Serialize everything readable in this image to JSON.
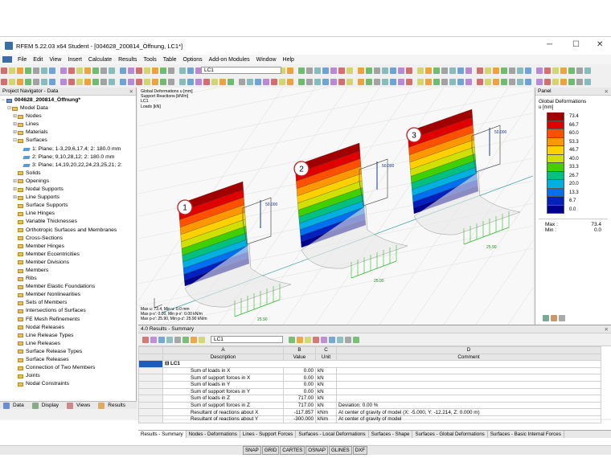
{
  "window": {
    "title": "RFEM 5.22.03 x64 Student - [004628_200814_Öffnung, LC1*]",
    "minimize": "─",
    "maximize": "☐",
    "close": "✕"
  },
  "menu": [
    "File",
    "Edit",
    "View",
    "Insert",
    "Calculate",
    "Results",
    "Tools",
    "Table",
    "Options",
    "Add-on Modules",
    "Window",
    "Help"
  ],
  "toolbar": {
    "loadcase": "LC1"
  },
  "navigator": {
    "title": "Project Navigator - Data",
    "root": "004628_200814_Öffnung*",
    "items": [
      {
        "label": "Model Data",
        "lvl": 1,
        "pm": "−"
      },
      {
        "label": "Nodes",
        "lvl": 2,
        "pm": "+"
      },
      {
        "label": "Lines",
        "lvl": 2,
        "pm": "+"
      },
      {
        "label": "Materials",
        "lvl": 2,
        "pm": "+"
      },
      {
        "label": "Surfaces",
        "lvl": 2,
        "pm": "−"
      },
      {
        "label": "1: Plane; 1-3,29,6,17,4; 2: 180.0 mm",
        "lvl": 3,
        "surf": true
      },
      {
        "label": "2: Plane; 9,10,28,12; 2: 180.0 mm",
        "lvl": 3,
        "surf": true
      },
      {
        "label": "3: Plane; 14,19,20,22,24,23,25,21; 2:",
        "lvl": 3,
        "surf": true
      },
      {
        "label": "Solids",
        "lvl": 2
      },
      {
        "label": "Openings",
        "lvl": 2,
        "pm": "+"
      },
      {
        "label": "Nodal Supports",
        "lvl": 2,
        "pm": "+"
      },
      {
        "label": "Line Supports",
        "lvl": 2,
        "pm": "+"
      },
      {
        "label": "Surface Supports",
        "lvl": 2
      },
      {
        "label": "Line Hinges",
        "lvl": 2
      },
      {
        "label": "Variable Thicknesses",
        "lvl": 2
      },
      {
        "label": "Orthotropic Surfaces and Membranes",
        "lvl": 2
      },
      {
        "label": "Cross-Sections",
        "lvl": 2
      },
      {
        "label": "Member Hinges",
        "lvl": 2
      },
      {
        "label": "Member Eccentricities",
        "lvl": 2
      },
      {
        "label": "Member Divisions",
        "lvl": 2
      },
      {
        "label": "Members",
        "lvl": 2
      },
      {
        "label": "Ribs",
        "lvl": 2
      },
      {
        "label": "Member Elastic Foundations",
        "lvl": 2
      },
      {
        "label": "Member Nonlinearities",
        "lvl": 2
      },
      {
        "label": "Sets of Members",
        "lvl": 2
      },
      {
        "label": "Intersections of Surfaces",
        "lvl": 2
      },
      {
        "label": "FE Mesh Refinements",
        "lvl": 2
      },
      {
        "label": "Nodal Releases",
        "lvl": 2
      },
      {
        "label": "Line Release Types",
        "lvl": 2
      },
      {
        "label": "Line Releases",
        "lvl": 2
      },
      {
        "label": "Surface Release Types",
        "lvl": 2
      },
      {
        "label": "Surface Releases",
        "lvl": 2
      },
      {
        "label": "Connection of Two Members",
        "lvl": 2
      },
      {
        "label": "Joints",
        "lvl": 2
      },
      {
        "label": "Nodal Constraints",
        "lvl": 2
      }
    ],
    "tabs": [
      "Data",
      "Display",
      "Views",
      "Results"
    ]
  },
  "viewport": {
    "info": [
      "Global Deformations u [mm]",
      "Support Reactions [kN/m]",
      "LC1",
      "Loads [kN]"
    ],
    "bottom": [
      "Max u: 73.4, Min u: 0.0 mm",
      "Max p-x': 0.00, Min p-x': 0.00 kN/m",
      "Max p-z': 25.90, Min p-z': 25.90 kN/m"
    ],
    "callouts": [
      "1",
      "2",
      "3"
    ],
    "loads": [
      "50.000",
      "50.000",
      "50.000"
    ],
    "reactions": [
      "25.90",
      "25.90",
      "25.90"
    ]
  },
  "panel": {
    "title": "Panel",
    "heading": "Global Deformations",
    "unit": "u [mm]",
    "legend": [
      "73.4",
      "66.7",
      "60.0",
      "53.3",
      "46.7",
      "40.0",
      "33.3",
      "26.7",
      "20.0",
      "13.3",
      "6.7",
      "0.0"
    ],
    "colors": [
      "#a00000",
      "#e00000",
      "#ff5000",
      "#ff9800",
      "#ffd000",
      "#d0e000",
      "#40d000",
      "#00c080",
      "#00b0e0",
      "#0070f0",
      "#0020c0",
      "#000090"
    ],
    "max_label": "Max :",
    "max": "73.4",
    "min_label": "Min :",
    "min": "0.0"
  },
  "results": {
    "title": "4.0 Results - Summary",
    "lc": "LC1",
    "cols": [
      [
        "A",
        "Description"
      ],
      [
        "B",
        "Value"
      ],
      [
        "C",
        "Unit"
      ],
      [
        "D",
        "Comment"
      ]
    ],
    "group": "LC1",
    "rows": [
      [
        "Sum of loads in X",
        "0.00",
        "kN",
        ""
      ],
      [
        "Sum of support forces in X",
        "0.00",
        "kN",
        ""
      ],
      [
        "Sum of loads in Y",
        "0.00",
        "kN",
        ""
      ],
      [
        "Sum of support forces in Y",
        "0.00",
        "kN",
        ""
      ],
      [
        "Sum of loads in Z",
        "717.00",
        "kN",
        ""
      ],
      [
        "Sum of support forces in Z",
        "717.00",
        "kN",
        "Deviation:  0.00 %"
      ],
      [
        "Resultant of reactions about X",
        "-117.857",
        "kNm",
        "At center of gravity of model (X: -5.000, Y: -12.214, Z: 0.000 m)"
      ],
      [
        "Resultant of reactions about Y",
        "-300.000",
        "kNm",
        "At center of gravity of model"
      ]
    ],
    "tabs": [
      "Results - Summary",
      "Nodes - Deformations",
      "Lines - Support Forces",
      "Surfaces - Local Deformations",
      "Surfaces - Shape",
      "Surfaces - Global Deformations",
      "Surfaces - Basic Internal Forces"
    ]
  },
  "status": [
    "SNAP",
    "GRID",
    "CARTES",
    "OSNAP",
    "GLINES",
    "DXF"
  ]
}
